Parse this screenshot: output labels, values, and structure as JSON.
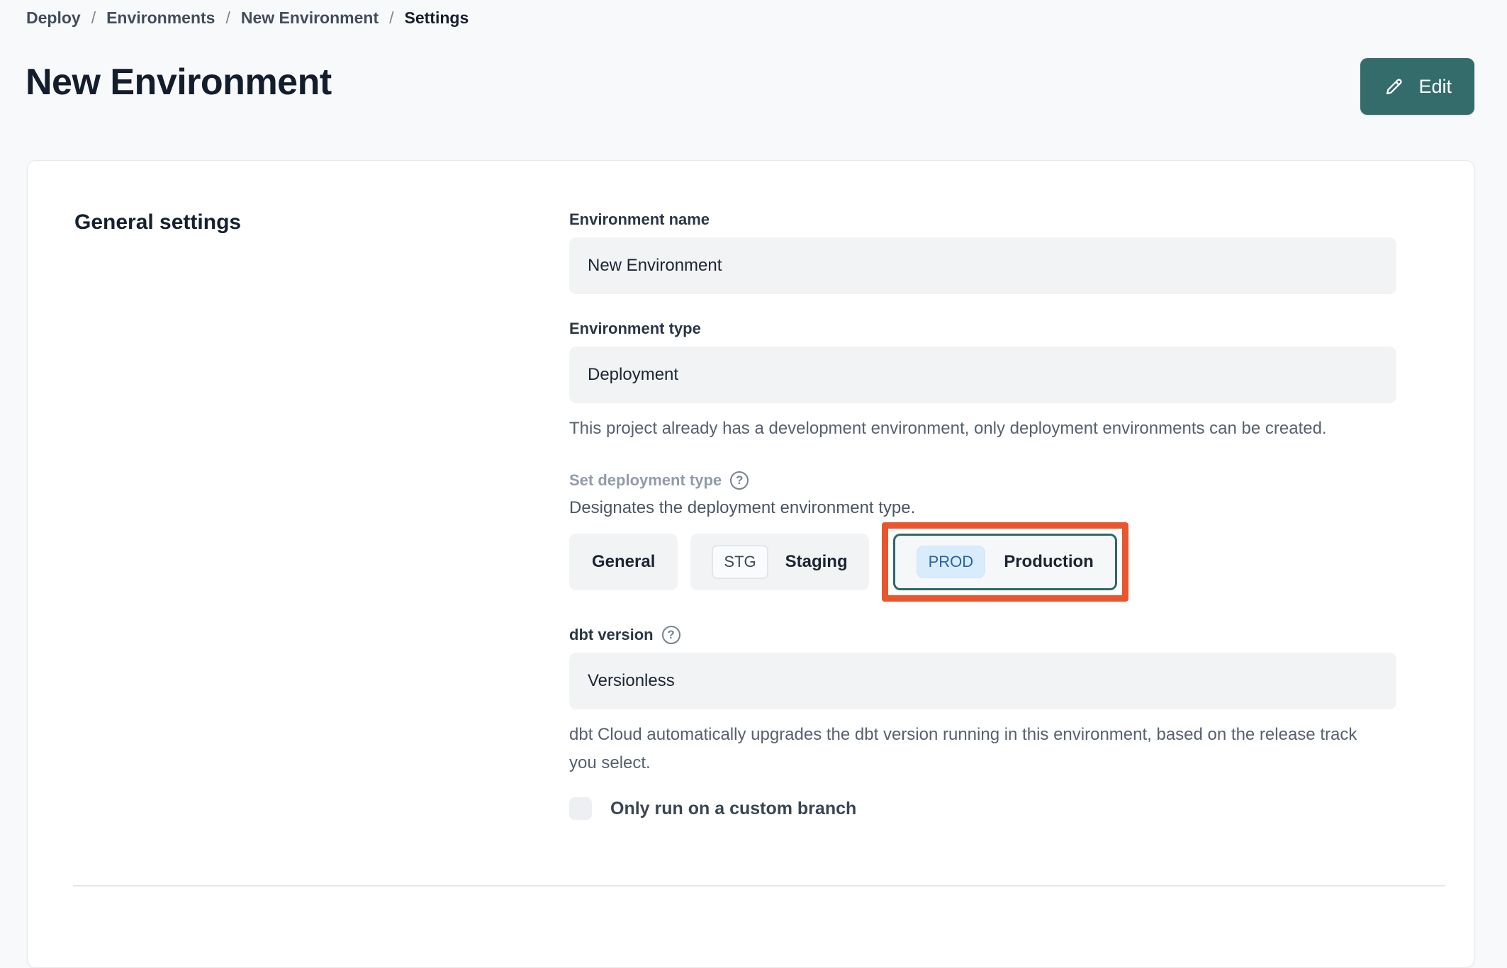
{
  "colors": {
    "accent_teal": "#336c6b",
    "production_border_teal": "#2b6a68",
    "annotation_orange": "#e9552d",
    "prod_badge_bg": "#d9ecfc",
    "prod_badge_text": "#27639f",
    "field_bg": "#f2f3f5",
    "page_bg": "#f8f9fb"
  },
  "icons": {
    "help_glyph": "?"
  },
  "page": {
    "breadcrumb": {
      "items": [
        "Deploy",
        "Environments",
        "New Environment",
        "Settings"
      ],
      "separator": "/"
    },
    "title": "New Environment",
    "edit_button_label": "Edit"
  },
  "card": {
    "heading": "General settings",
    "environment_name": {
      "label": "Environment name",
      "value": "New Environment"
    },
    "environment_type": {
      "label": "Environment type",
      "value": "Deployment",
      "help_text": "This project already has a development environment, only deployment environments can be created."
    },
    "deployment_type": {
      "label": "Set deployment type",
      "description": "Designates the deployment environment type.",
      "options": [
        {
          "label": "General",
          "selected": false
        },
        {
          "badge": "STG",
          "label": "Staging",
          "selected": false
        },
        {
          "badge": "PROD",
          "label": "Production",
          "selected": true,
          "annotated": true
        }
      ]
    },
    "dbt_version": {
      "label": "dbt version",
      "value": "Versionless",
      "help_text": "dbt Cloud automatically upgrades the dbt version running in this environment, based on the release track you select."
    },
    "custom_branch": {
      "label": "Only run on a custom branch",
      "checked": false
    }
  }
}
